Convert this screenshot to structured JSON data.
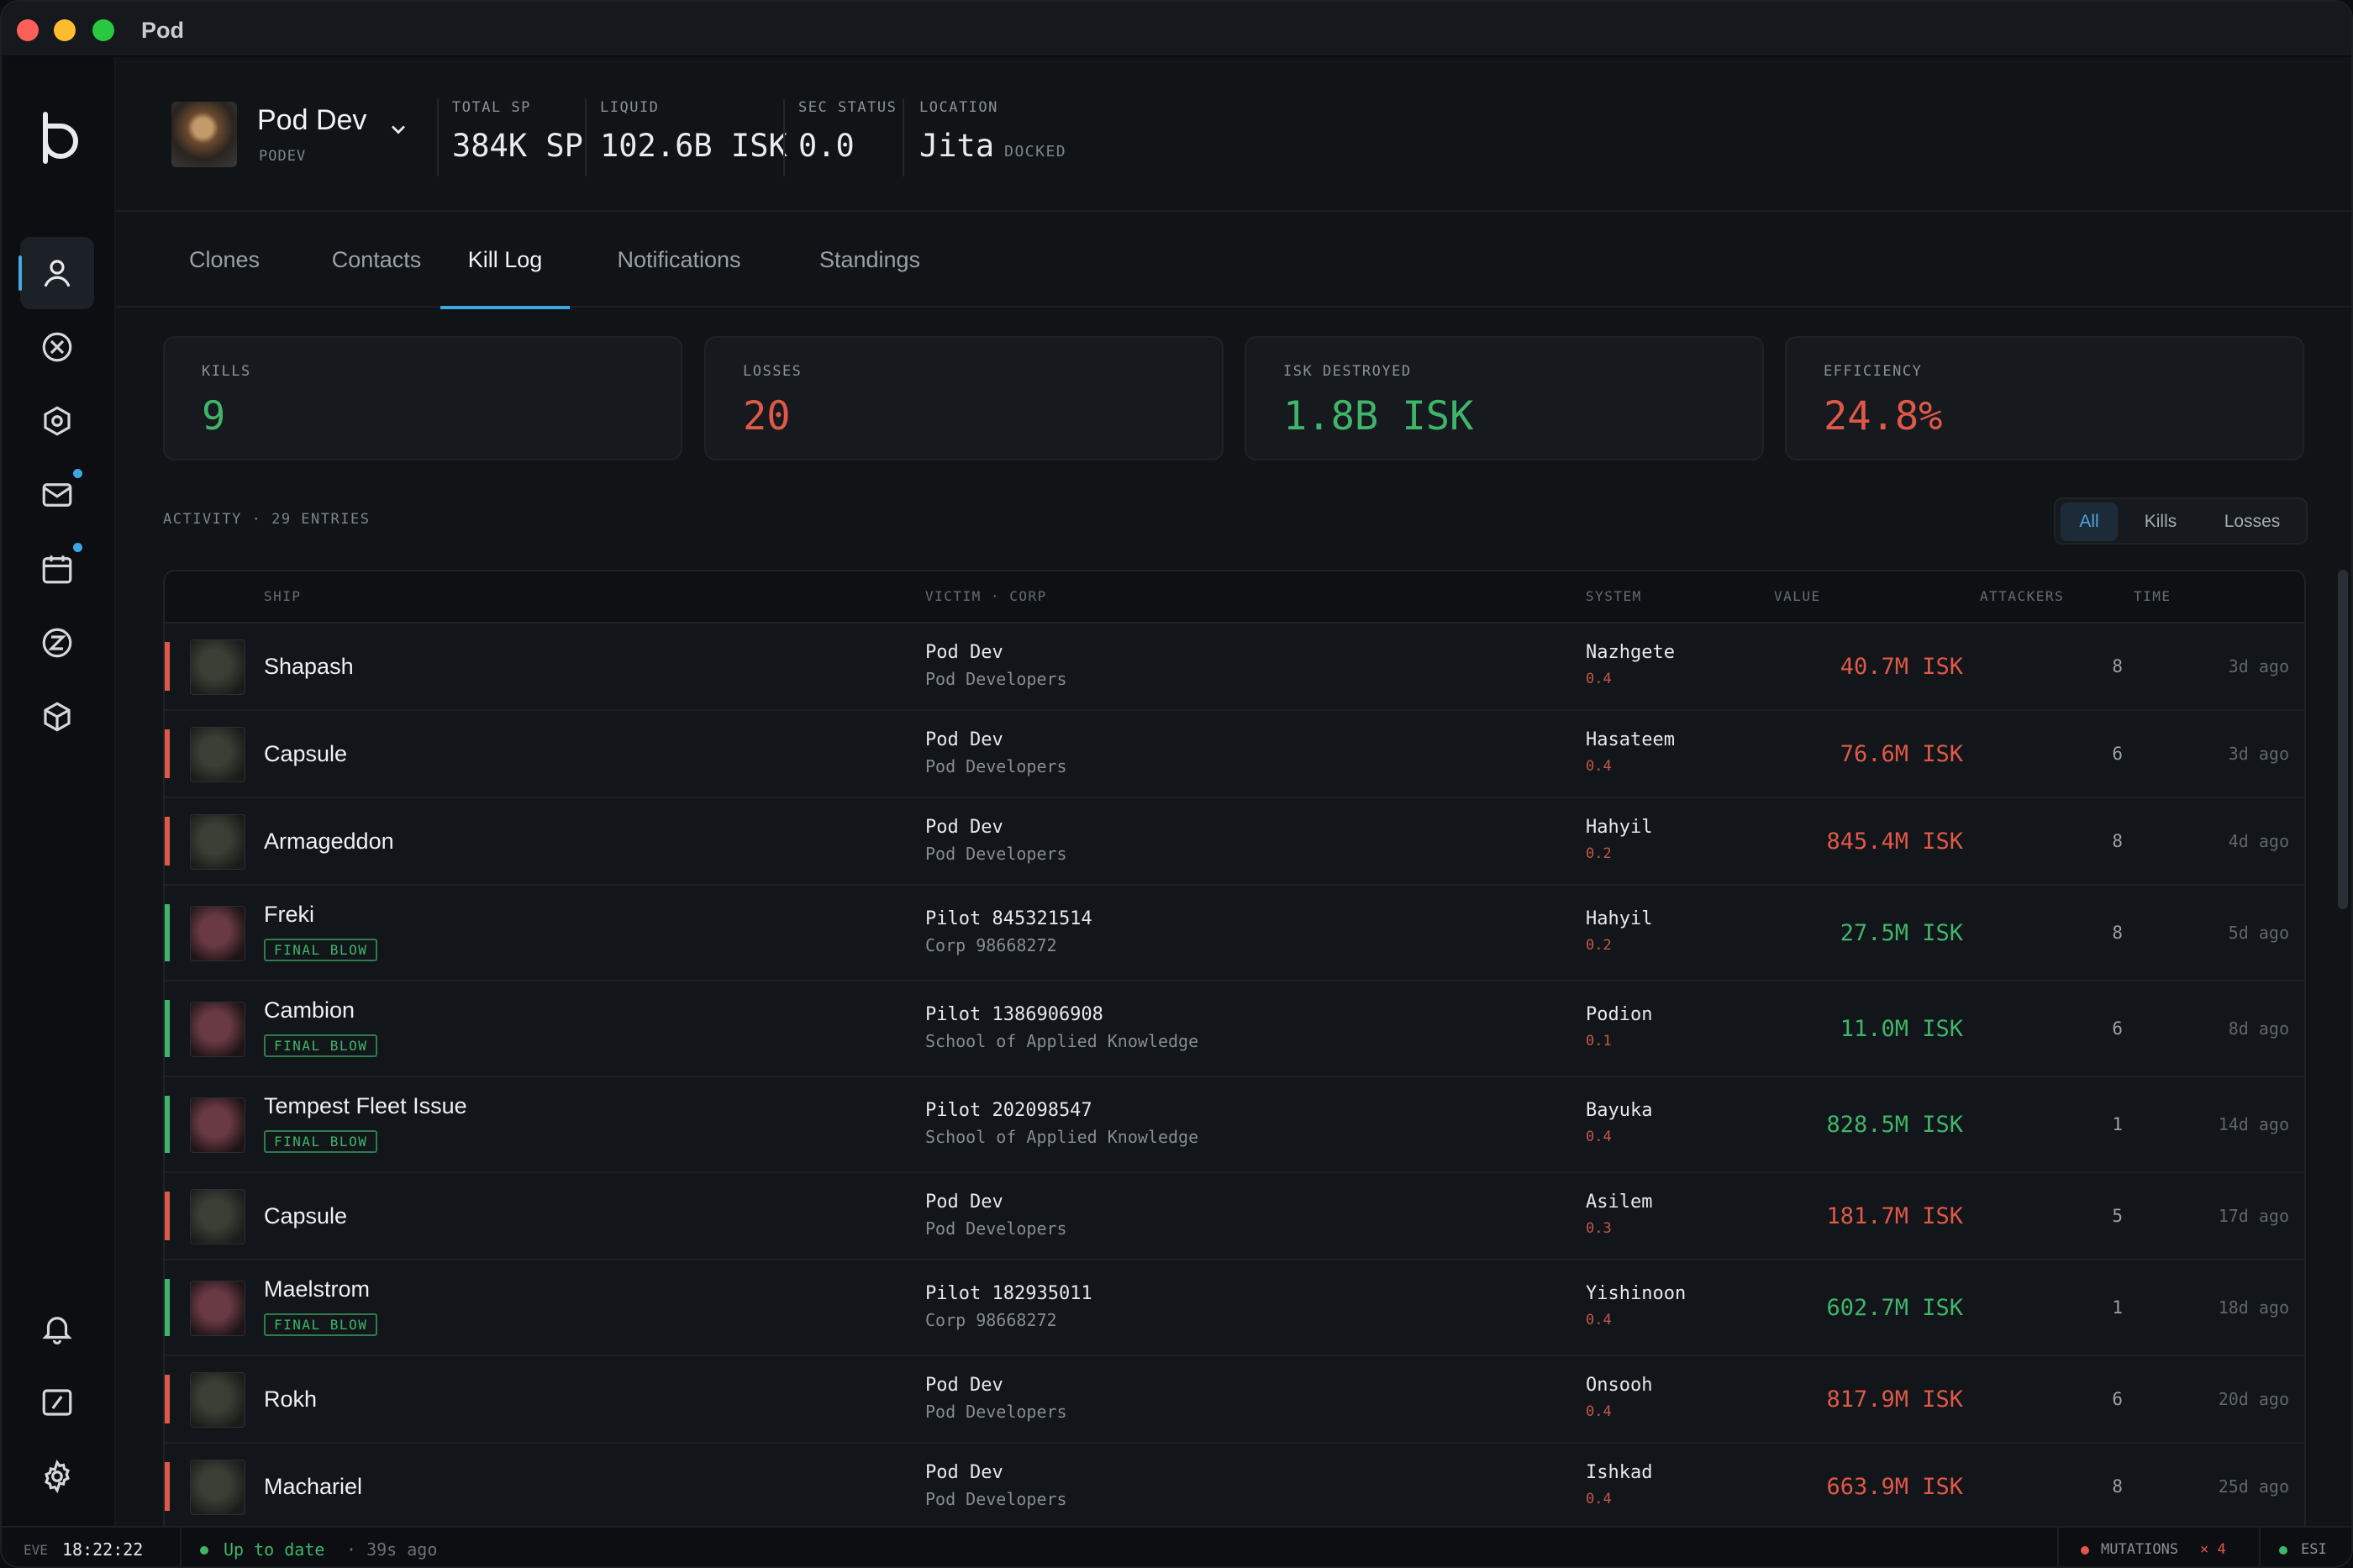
{
  "window": {
    "title": "Pod"
  },
  "character": {
    "name": "Pod Dev",
    "ticker": "PODEV",
    "stats": [
      {
        "label": "TOTAL SP",
        "value": "384K SP"
      },
      {
        "label": "LIQUID",
        "value": "102.6B ISK"
      },
      {
        "label": "SEC STATUS",
        "value": "0.0"
      },
      {
        "label": "LOCATION",
        "value": "Jita",
        "sub": "DOCKED"
      }
    ]
  },
  "tabs": [
    "Clones",
    "Contacts",
    "Kill Log",
    "Notifications",
    "Standings"
  ],
  "active_tab": "Kill Log",
  "summary": [
    {
      "label": "KILLS",
      "value": "9",
      "color": "#3fb56a"
    },
    {
      "label": "LOSSES",
      "value": "20",
      "color": "#e05848"
    },
    {
      "label": "ISK DESTROYED",
      "value": "1.8B ISK",
      "color": "#3fb56a"
    },
    {
      "label": "EFFICIENCY",
      "value": "24.8%",
      "color": "#e05848"
    }
  ],
  "activity": {
    "label": "ACTIVITY · 29 ENTRIES",
    "filters": [
      "All",
      "Kills",
      "Losses"
    ],
    "active_filter": "All"
  },
  "table": {
    "headers": {
      "ship": "SHIP",
      "victim": "VICTIM · CORP",
      "system": "SYSTEM",
      "value": "VALUE",
      "attackers": "ATTACKERS",
      "time": "TIME"
    },
    "rows": [
      {
        "type": "loss",
        "ship": "Shapash",
        "victim": "Pod Dev",
        "corp": "Pod Developers",
        "system": "Nazhgete",
        "sec": "0.4",
        "value": "40.7M ISK",
        "attackers": "8",
        "time": "3d ago"
      },
      {
        "type": "loss",
        "ship": "Capsule",
        "victim": "Pod Dev",
        "corp": "Pod Developers",
        "system": "Hasateem",
        "sec": "0.4",
        "value": "76.6M ISK",
        "attackers": "6",
        "time": "3d ago"
      },
      {
        "type": "loss",
        "ship": "Armageddon",
        "victim": "Pod Dev",
        "corp": "Pod Developers",
        "system": "Hahyil",
        "sec": "0.2",
        "value": "845.4M ISK",
        "attackers": "8",
        "time": "4d ago"
      },
      {
        "type": "kill",
        "ship": "Freki",
        "badge": "FINAL BLOW",
        "victim": "Pilot 845321514",
        "corp": "Corp 98668272",
        "system": "Hahyil",
        "sec": "0.2",
        "value": "27.5M ISK",
        "attackers": "8",
        "time": "5d ago"
      },
      {
        "type": "kill",
        "ship": "Cambion",
        "badge": "FINAL BLOW",
        "victim": "Pilot 1386906908",
        "corp": "School of Applied Knowledge",
        "system": "Podion",
        "sec": "0.1",
        "value": "11.0M ISK",
        "attackers": "6",
        "time": "8d ago"
      },
      {
        "type": "kill",
        "ship": "Tempest Fleet Issue",
        "badge": "FINAL BLOW",
        "victim": "Pilot 202098547",
        "corp": "School of Applied Knowledge",
        "system": "Bayuka",
        "sec": "0.4",
        "value": "828.5M ISK",
        "attackers": "1",
        "time": "14d ago"
      },
      {
        "type": "loss",
        "ship": "Capsule",
        "victim": "Pod Dev",
        "corp": "Pod Developers",
        "system": "Asilem",
        "sec": "0.3",
        "value": "181.7M ISK",
        "attackers": "5",
        "time": "17d ago"
      },
      {
        "type": "kill",
        "ship": "Maelstrom",
        "badge": "FINAL BLOW",
        "victim": "Pilot 182935011",
        "corp": "Corp 98668272",
        "system": "Yishinoon",
        "sec": "0.4",
        "value": "602.7M ISK",
        "attackers": "1",
        "time": "18d ago"
      },
      {
        "type": "loss",
        "ship": "Rokh",
        "victim": "Pod Dev",
        "corp": "Pod Developers",
        "system": "Onsooh",
        "sec": "0.4",
        "value": "817.9M ISK",
        "attackers": "6",
        "time": "20d ago"
      },
      {
        "type": "loss",
        "ship": "Machariel",
        "victim": "Pod Dev",
        "corp": "Pod Developers",
        "system": "Ishkad",
        "sec": "0.4",
        "value": "663.9M ISK",
        "attackers": "8",
        "time": "25d ago"
      }
    ]
  },
  "statusbar": {
    "eve_label": "EVE",
    "clock": "18:22:22",
    "sync_status": "Up to date",
    "sync_age": "· 39s ago",
    "mutations_label": "MUTATIONS",
    "mutations_count": "× 4",
    "esi_label": "ESI"
  },
  "colors": {
    "kill": "#3fb56a",
    "loss": "#e05848",
    "accent": "#3fa6e6"
  },
  "icons": [
    "pod-logo-icon",
    "character-icon",
    "crossed-circle-icon",
    "hexagon-icon",
    "mail-icon",
    "calendar-icon",
    "token-icon",
    "cube-icon",
    "bell-icon",
    "gauge-icon",
    "gear-icon"
  ]
}
